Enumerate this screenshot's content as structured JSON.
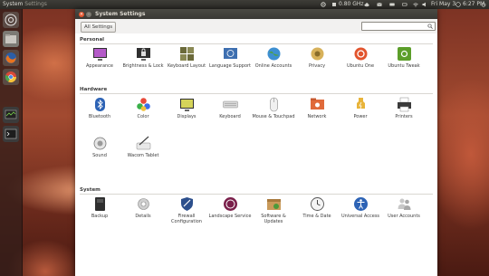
{
  "top_panel": {
    "app_title": "System",
    "app_title_suffix": "Settings",
    "cpu_label": "0.80 GHz",
    "clock": "Fri May 3",
    "time": "6:27 PM"
  },
  "window": {
    "title": "System Settings",
    "all_settings_label": "All Settings",
    "search_value": ""
  },
  "sections": [
    {
      "title": "Personal",
      "items": [
        {
          "label": "Appearance",
          "icon": "appearance-icon"
        },
        {
          "label": "Brightness & Lock",
          "icon": "brightness-lock-icon"
        },
        {
          "label": "Keyboard Layout",
          "icon": "keyboard-layout-icon"
        },
        {
          "label": "Language Support",
          "icon": "language-support-icon"
        },
        {
          "label": "Online Accounts",
          "icon": "online-accounts-icon"
        },
        {
          "label": "Privacy",
          "icon": "privacy-icon"
        },
        {
          "label": "Ubuntu One",
          "icon": "ubuntu-one-icon"
        },
        {
          "label": "Ubuntu Tweak",
          "icon": "ubuntu-tweak-icon"
        }
      ]
    },
    {
      "title": "Hardware",
      "items": [
        {
          "label": "Bluetooth",
          "icon": "bluetooth-icon"
        },
        {
          "label": "Color",
          "icon": "color-icon"
        },
        {
          "label": "Displays",
          "icon": "displays-icon"
        },
        {
          "label": "Keyboard",
          "icon": "keyboard-icon"
        },
        {
          "label": "Mouse & Touchpad",
          "icon": "mouse-touchpad-icon"
        },
        {
          "label": "Network",
          "icon": "network-icon"
        },
        {
          "label": "Power",
          "icon": "power-icon"
        },
        {
          "label": "Printers",
          "icon": "printers-icon"
        },
        {
          "label": "Sound",
          "icon": "sound-icon"
        },
        {
          "label": "Wacom Tablet",
          "icon": "wacom-tablet-icon"
        }
      ]
    },
    {
      "title": "System",
      "items": [
        {
          "label": "Backup",
          "icon": "backup-icon"
        },
        {
          "label": "Details",
          "icon": "details-icon"
        },
        {
          "label": "Firewall Configuration",
          "icon": "firewall-icon"
        },
        {
          "label": "Landscape Service",
          "icon": "landscape-icon"
        },
        {
          "label": "Software & Updates",
          "icon": "software-updates-icon"
        },
        {
          "label": "Time & Date",
          "icon": "time-date-icon"
        },
        {
          "label": "Universal Access",
          "icon": "universal-access-icon"
        },
        {
          "label": "User Accounts",
          "icon": "user-accounts-icon"
        }
      ]
    }
  ],
  "launcher": [
    {
      "icon": "dash-home-icon"
    },
    {
      "icon": "files-icon"
    },
    {
      "icon": "firefox-icon"
    },
    {
      "icon": "chromium-icon"
    },
    {
      "icon": "system-monitor-icon"
    },
    {
      "icon": "terminal-icon"
    }
  ]
}
